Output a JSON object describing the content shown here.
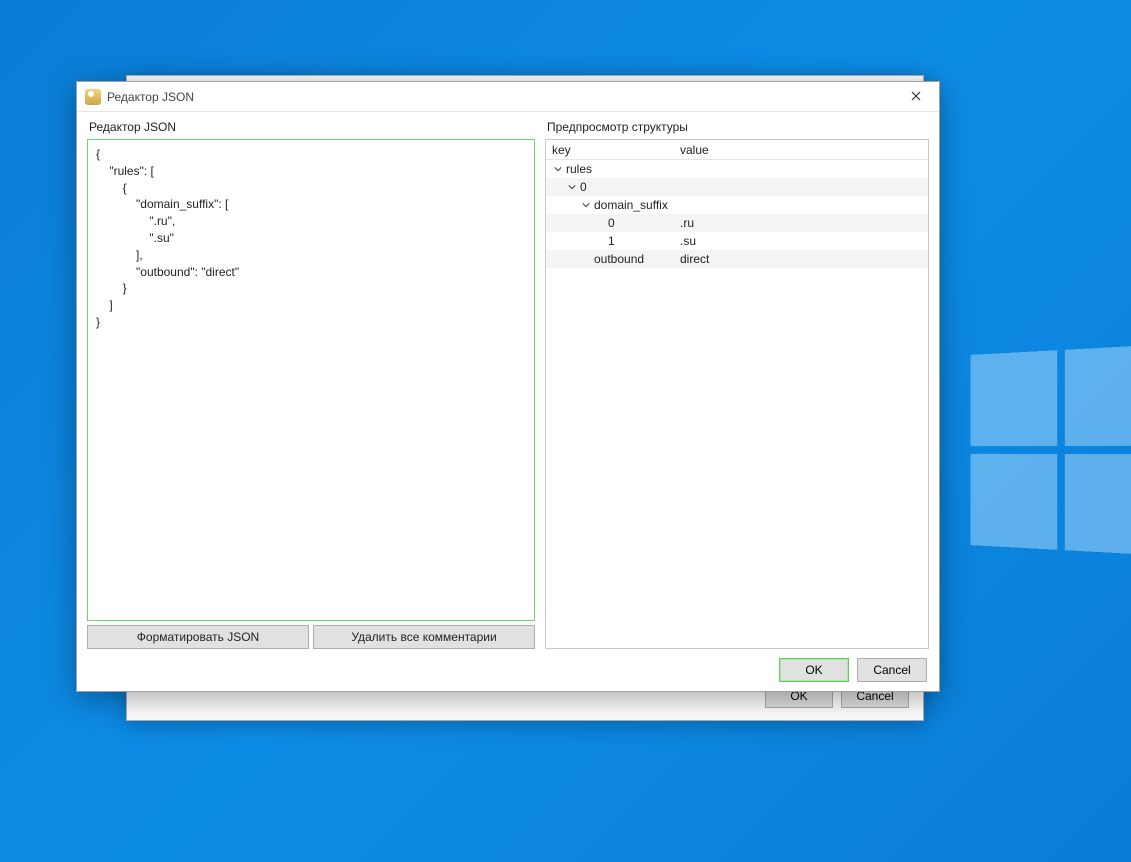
{
  "dialog": {
    "title": "Редактор JSON",
    "left_label": "Редактор JSON",
    "right_label": "Предпросмотр структуры",
    "editor_text": "{\n    \"rules\": [\n        {\n            \"domain_suffix\": [\n                \".ru\",\n                \".su\"\n            ],\n            \"outbound\": \"direct\"\n        }\n    ]\n}",
    "format_btn": "Форматировать JSON",
    "strip_btn": "Удалить все комментарии",
    "ok_btn": "OK",
    "cancel_btn": "Cancel"
  },
  "tree": {
    "header_key": "key",
    "header_value": "value",
    "rows": [
      {
        "indent": 0,
        "chevron": true,
        "key": "rules",
        "value": ""
      },
      {
        "indent": 1,
        "chevron": true,
        "key": "0",
        "value": ""
      },
      {
        "indent": 2,
        "chevron": true,
        "key": "domain_suffix",
        "value": ""
      },
      {
        "indent": 3,
        "chevron": false,
        "key": "0",
        "value": ".ru"
      },
      {
        "indent": 3,
        "chevron": false,
        "key": "1",
        "value": ".su"
      },
      {
        "indent": 2,
        "chevron": false,
        "key": "outbound",
        "value": "direct"
      }
    ]
  },
  "back": {
    "ok": "OK",
    "cancel": "Cancel"
  }
}
